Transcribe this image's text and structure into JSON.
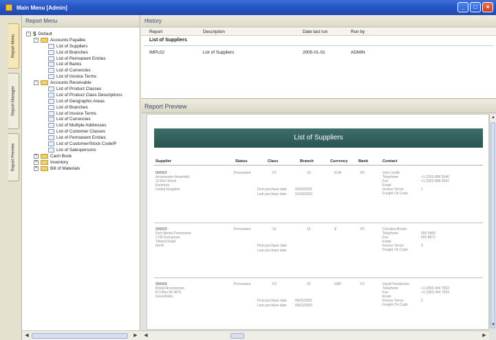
{
  "window": {
    "title": "Main Menu   [Admin]",
    "controls": [
      "_",
      "□",
      "×"
    ]
  },
  "side_tabs": [
    "Report Menu",
    "Report Manager",
    "Report Preview"
  ],
  "report_menu": {
    "title": "Report Menu",
    "tree": [
      {
        "level": 0,
        "exp": "−",
        "type": "dollar",
        "label": "Default"
      },
      {
        "level": 1,
        "exp": "−",
        "type": "folder",
        "label": "Accounts Payable"
      },
      {
        "level": 2,
        "type": "doc",
        "label": "List of Suppliers"
      },
      {
        "level": 2,
        "type": "doc",
        "label": "List of Branches"
      },
      {
        "level": 2,
        "type": "doc",
        "label": "List of Permanent Entries"
      },
      {
        "level": 2,
        "type": "doc",
        "label": "List of Banks"
      },
      {
        "level": 2,
        "type": "doc",
        "label": "List of Currencies"
      },
      {
        "level": 2,
        "type": "doc",
        "label": "List of Invoice Terms"
      },
      {
        "level": 1,
        "exp": "−",
        "type": "folder",
        "label": "Accounts Receivable"
      },
      {
        "level": 2,
        "type": "doc",
        "label": "List of Product Classes"
      },
      {
        "level": 2,
        "type": "doc",
        "label": "List of Product Class Descriptions"
      },
      {
        "level": 2,
        "type": "doc",
        "label": "List of Geographic Areas"
      },
      {
        "level": 2,
        "type": "doc",
        "label": "List of Branches"
      },
      {
        "level": 2,
        "type": "doc",
        "label": "List of Invoice Terms"
      },
      {
        "level": 2,
        "type": "doc",
        "label": "List of Currencies"
      },
      {
        "level": 2,
        "type": "doc",
        "label": "List of Multiple Addresses"
      },
      {
        "level": 2,
        "type": "doc",
        "label": "List of Customer Classes"
      },
      {
        "level": 2,
        "type": "doc",
        "label": "List of Permanent Entries"
      },
      {
        "level": 2,
        "type": "doc",
        "label": "List of Customer/Stock Code/P"
      },
      {
        "level": 2,
        "type": "doc",
        "label": "List of Salespersons"
      },
      {
        "level": 1,
        "exp": "+",
        "type": "folder",
        "label": "Cash Book"
      },
      {
        "level": 1,
        "exp": "+",
        "type": "folder",
        "label": "Inventory"
      },
      {
        "level": 1,
        "exp": "+",
        "type": "folder",
        "label": "Bill of Materials"
      }
    ]
  },
  "history": {
    "title": "History",
    "columns": [
      "Report",
      "Description",
      "Date last run",
      "Run by"
    ],
    "group": "List of Suppliers",
    "rows": [
      {
        "report": "IMPL02",
        "description": "List of Suppliers",
        "date": "2005-01-01",
        "run_by": "ADMIN"
      }
    ]
  },
  "preview": {
    "title": "Report Preview",
    "report_title": "List of Suppliers",
    "columns": [
      "Supplier",
      "Status",
      "Class",
      "Branch",
      "Currency",
      "Bank",
      "Contact"
    ],
    "records": [
      {
        "code": "000002",
        "lines": [
          "Accessories Assembly",
          "10 Elm Street",
          "Kenmore",
          "United Kingdom"
        ],
        "status": "Permanent",
        "class": "P1",
        "branch": "10",
        "currency": "EUR",
        "bank": "F6",
        "contact": [
          "John Smith",
          "Telephone",
          "Fax",
          "Email",
          "Invoice Terms",
          "Freight On Code"
        ],
        "contact_vals": [
          "+1 (250) 888 5540",
          "+1 (250) 888 5547",
          "",
          "1",
          ""
        ],
        "dates": [
          "First purchase date",
          "Last purchase date"
        ],
        "date_vals": [
          "06/03/2001",
          "01/09/2003"
        ]
      },
      {
        "code": "000003",
        "lines": [
          "Rich Media Promotions",
          "1735 Evergreen",
          "Tolland Road",
          "North"
        ],
        "status": "Permanent",
        "class": "S1",
        "branch": "15",
        "currency": "$",
        "bank": "F5",
        "contact": [
          "Christina Brown",
          "Telephone",
          "Fax",
          "Email",
          "Invoice Terms",
          "Freight On Code"
        ],
        "contact_vals": [
          "555 5890",
          "555 8872",
          "",
          "3",
          ""
        ],
        "dates": [
          "First purchase date",
          "Last purchase date"
        ],
        "date_vals": [
          "",
          ""
        ]
      },
      {
        "code": "000004",
        "lines": [
          "Bristol Accessories",
          "P.O.Box 84 9876",
          "Greenfields"
        ],
        "status": "Permanent",
        "class": "P2",
        "branch": "20",
        "currency": "GBP",
        "bank": "F3",
        "contact": [
          "David Henderson",
          "Telephone",
          "Fax",
          "Email",
          "Invoice Terms",
          "Freight On Code"
        ],
        "contact_vals": [
          "+1 (250) 444 7652",
          "+1 (250) 444 7653",
          "",
          "2",
          ""
        ],
        "dates": [
          "First purchase date",
          "Last purchase date"
        ],
        "date_vals": [
          "06/01/2001",
          "08/01/2003"
        ]
      }
    ]
  }
}
